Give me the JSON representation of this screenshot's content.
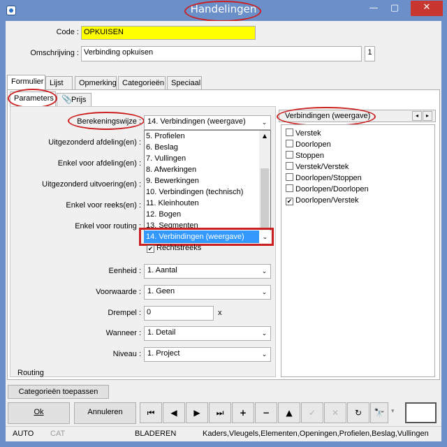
{
  "window": {
    "title": "Handelingen",
    "min": "—",
    "max": "▢",
    "close": "✕"
  },
  "form": {
    "code_label": "Code :",
    "code_value": "OPKUISEN",
    "omschrijving_label": "Omschrijving :",
    "omschrijving_value": "Verbinding opkuisen",
    "omschrijving_count": "1"
  },
  "tabs": [
    "Formulier",
    "Lijst",
    "Opmerking",
    "Categorieën",
    "Speciaal"
  ],
  "subtabs": [
    "Parameters",
    "Prijs"
  ],
  "params": {
    "berekeningswijze_label": "Berekeningswijze :",
    "berekeningswijze_value": "14. Verbindingen (weergave)",
    "uitgezonderd_afdeling_label": "Uitgezonderd afdeling(en) :",
    "enkel_afdeling_label": "Enkel voor afdeling(en) :",
    "uitgezonderd_uitvoering_label": "Uitgezonderd uitvoering(en) :",
    "enkel_reeks_label": "Enkel voor reeks(en) :",
    "enkel_routing_label": "Enkel voor routing :",
    "rechtstreeks_label": "Rechtstreeks",
    "eenheid_label": "Eenheid :",
    "eenheid_value": "1. Aantal",
    "voorwaarde_label": "Voorwaarde :",
    "voorwaarde_value": "1. Geen",
    "drempel_label": "Drempel :",
    "drempel_value": "0",
    "drempel_unit": "x",
    "wanneer_label": "Wanneer :",
    "wanneer_value": "1. Detail",
    "niveau_label": "Niveau :",
    "niveau_value": "1. Project",
    "routing_label": "Routing"
  },
  "dropdown_items": [
    "5. Profielen",
    "6. Beslag",
    "7. Vullingen",
    "8. Afwerkingen",
    "9. Bewerkingen",
    "10. Verbindingen (technisch)",
    "11. Kleinhouten",
    "12. Bogen",
    "13. Segmenten"
  ],
  "dropdown_selected": "14. Verbindingen (weergave)",
  "right_panel": {
    "title": "Verbindingen (weergave)",
    "items": [
      {
        "label": "Verstek",
        "checked": false
      },
      {
        "label": "Doorlopen",
        "checked": false
      },
      {
        "label": "Stoppen",
        "checked": false
      },
      {
        "label": "Verstek/Verstek",
        "checked": false
      },
      {
        "label": "Doorlopen/Stoppen",
        "checked": false
      },
      {
        "label": "Doorlopen/Doorlopen",
        "checked": false
      },
      {
        "label": "Doorlopen/Verstek",
        "checked": true
      }
    ]
  },
  "buttons": {
    "categorieen_toepassen": "Categorieën toepassen",
    "ok": "Ok",
    "annuleren": "Annuleren"
  },
  "status": {
    "auto": "AUTO",
    "cat": "CAT",
    "mode": "BLADEREN",
    "path": "Kaders,Vleugels,Elementen,Openingen,Profielen,Beslag,Vullingen"
  },
  "colors": {
    "title_bar": "#6b90c9",
    "code_bg": "#ffff00",
    "selection": "#3399ff",
    "annotation": "#cc1f1f"
  }
}
